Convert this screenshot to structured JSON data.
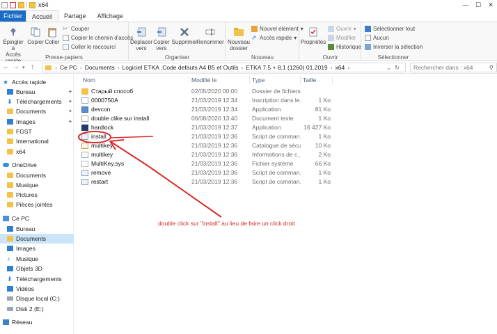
{
  "window": {
    "title": "x64",
    "controls": [
      "—",
      "☐",
      "✕"
    ]
  },
  "ribbon_tabs": [
    "Fichier",
    "Accueil",
    "Partage",
    "Affichage"
  ],
  "ribbon": {
    "presse_papiers": {
      "label": "Presse-papiers",
      "pin": "Épingler à\nAccès rapide",
      "copy": "Copier",
      "paste": "Coller",
      "cut": "Couper",
      "copy_path": "Copier le chemin d'accès",
      "paste_shortcut": "Coller le raccourci"
    },
    "organiser": {
      "label": "Organiser",
      "move": "Déplacer\nvers",
      "copyto": "Copier\nvers",
      "delete": "Supprimer",
      "rename": "Renommer"
    },
    "nouveau": {
      "label": "Nouveau",
      "new_folder": "Nouveau\ndossier",
      "new_item": "Nouvel élément",
      "quick_access": "Accès rapide"
    },
    "ouvrir": {
      "label": "Ouvrir",
      "properties": "Propriétés",
      "open": "Ouvrir",
      "edit": "Modifier",
      "history": "Historique"
    },
    "selectionner": {
      "label": "Sélectionner",
      "select_all": "Sélectionner tout",
      "none": "Aucun",
      "invert": "Inverser la sélection"
    }
  },
  "address": {
    "crumbs": [
      "Ce PC",
      "Documents",
      "Logiciel ETKA ,Code defauts A4 B5 et Outils",
      "ETKA 7.5 + 8.1 (1260) 01.2019",
      "x64"
    ],
    "search_placeholder": "Rechercher dans : x64"
  },
  "nav": [
    {
      "label": "Accès rapide",
      "icon": "star"
    },
    {
      "label": "Bureau",
      "icon": "blue",
      "pinned": true
    },
    {
      "label": "Téléchargements",
      "icon": "dl",
      "pinned": true
    },
    {
      "label": "Documents",
      "icon": "folder",
      "pinned": true
    },
    {
      "label": "Images",
      "icon": "blue",
      "pinned": true
    },
    {
      "label": "FGST",
      "icon": "folder"
    },
    {
      "label": "International",
      "icon": "folder"
    },
    {
      "label": "x64",
      "icon": "folder"
    },
    {
      "label": "OneDrive",
      "icon": "cloud"
    },
    {
      "label": "Documents",
      "icon": "folder"
    },
    {
      "label": "Musique",
      "icon": "folder"
    },
    {
      "label": "Pictures",
      "icon": "folder"
    },
    {
      "label": "Pièces jointes",
      "icon": "folder"
    },
    {
      "label": "Ce PC",
      "icon": "pc"
    },
    {
      "label": "Bureau",
      "icon": "blue"
    },
    {
      "label": "Documents",
      "icon": "folder",
      "selected": true
    },
    {
      "label": "Images",
      "icon": "blue"
    },
    {
      "label": "Musique",
      "icon": "music"
    },
    {
      "label": "Objets 3D",
      "icon": "blue"
    },
    {
      "label": "Téléchargements",
      "icon": "dl"
    },
    {
      "label": "Vidéos",
      "icon": "blue"
    },
    {
      "label": "Disque local (C:)",
      "icon": "drive"
    },
    {
      "label": "Disk 2 (E:)",
      "icon": "drive"
    },
    {
      "label": "Réseau",
      "icon": "net"
    }
  ],
  "columns": {
    "name": "Nom",
    "date": "Modifié le",
    "type": "Type",
    "size": "Taille"
  },
  "files": [
    {
      "name": "Старый способ",
      "date": "02/05/2020 00:00",
      "type": "Dossier de fichiers",
      "size": "",
      "icon": "folder"
    },
    {
      "name": "0000750A",
      "date": "21/03/2019 12:34",
      "type": "Inscription dans le...",
      "size": "1 Ko",
      "icon": "reg"
    },
    {
      "name": "devcon",
      "date": "21/03/2019 12:34",
      "type": "Application",
      "size": "81 Ko",
      "icon": "app"
    },
    {
      "name": "double clike sur install",
      "date": "06/08/2020 13:40",
      "type": "Document texte",
      "size": "1 Ko",
      "icon": "doc"
    },
    {
      "name": "hardlock",
      "date": "21/03/2019 12:37",
      "type": "Application",
      "size": "16 427 Ko",
      "icon": "hard"
    },
    {
      "name": "install",
      "date": "21/03/2019 12:36",
      "type": "Script de comman...",
      "size": "1 Ko",
      "icon": "bat"
    },
    {
      "name": "multikey",
      "date": "21/03/2019 12:36",
      "type": "Catalogue de sécu...",
      "size": "10 Ko",
      "icon": "cat"
    },
    {
      "name": "multikey",
      "date": "21/03/2019 12:36",
      "type": "Informations de c...",
      "size": "2 Ko",
      "icon": "doc"
    },
    {
      "name": "MultiKey.sys",
      "date": "21/03/2019 12:36",
      "type": "Fichier système",
      "size": "66 Ko",
      "icon": "sys"
    },
    {
      "name": "remove",
      "date": "21/03/2019 12:36",
      "type": "Script de comman...",
      "size": "1 Ko",
      "icon": "bat"
    },
    {
      "name": "restart",
      "date": "21/03/2019 12:36",
      "type": "Script de comman...",
      "size": "1 Ko",
      "icon": "bat"
    }
  ],
  "annotation": "double click sur \"install\" au lieu de faire un click droit",
  "colors": {
    "accent": "#1a6cc4",
    "annotation": "#d62b2b",
    "selection": "#cce4f7"
  }
}
